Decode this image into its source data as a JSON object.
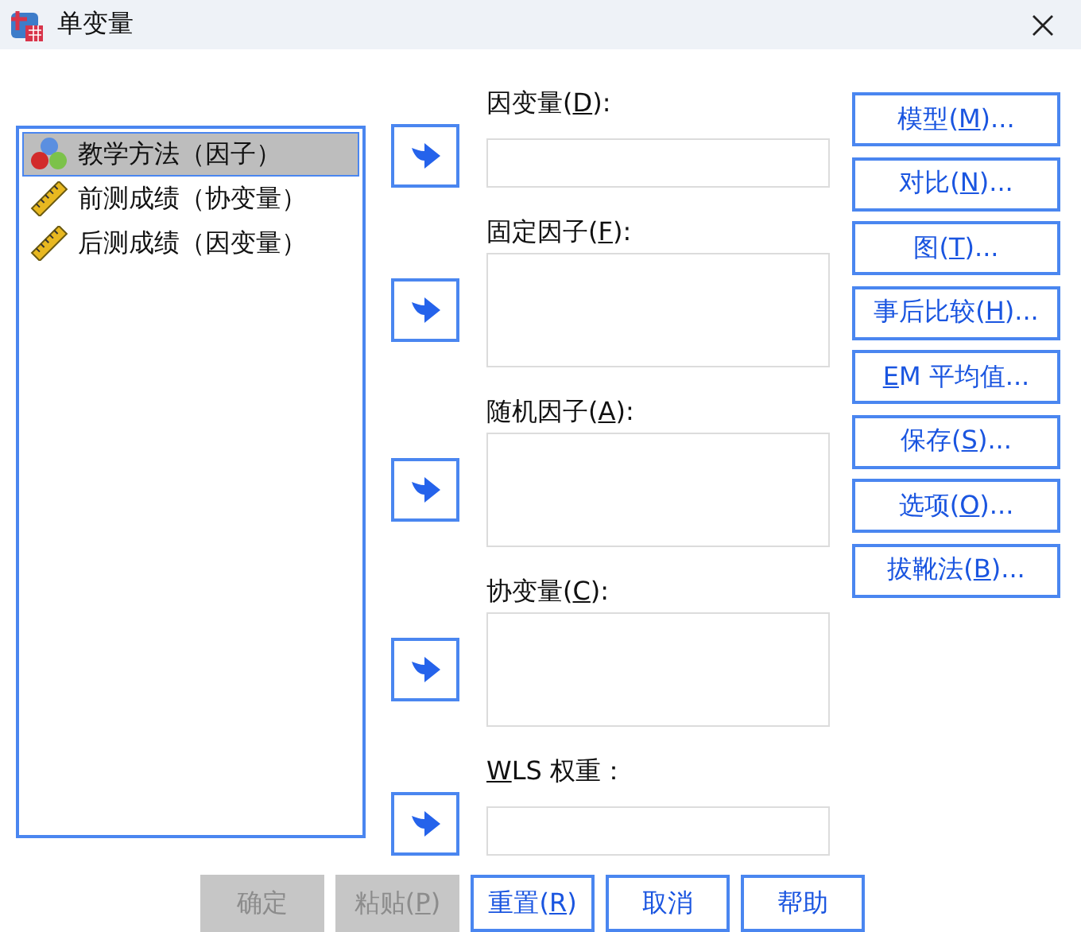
{
  "window": {
    "title": "单变量"
  },
  "variables": [
    {
      "name": "教学方法（因子）",
      "kind": "nominal",
      "selected": true
    },
    {
      "name": "前测成绩（协变量）",
      "kind": "scale",
      "selected": false
    },
    {
      "name": "后测成绩（因变量）",
      "kind": "scale",
      "selected": false
    }
  ],
  "targets": [
    {
      "before": "因变量(",
      "mnemonic": "D",
      "after": "):",
      "kind": "single"
    },
    {
      "before": "固定因子(",
      "mnemonic": "F",
      "after": "):",
      "kind": "multi"
    },
    {
      "before": "随机因子(",
      "mnemonic": "A",
      "after": "):",
      "kind": "multi"
    },
    {
      "before": "协变量(",
      "mnemonic": "C",
      "after": "):",
      "kind": "multi"
    },
    {
      "mnemonic": "W",
      "after": "LS 权重：",
      "kind": "single"
    }
  ],
  "side_buttons": [
    {
      "before": "模型(",
      "mnemonic": "M",
      "after": ")..."
    },
    {
      "before": "对比(",
      "mnemonic": "N",
      "after": ")..."
    },
    {
      "before": "图(",
      "mnemonic": "T",
      "after": ")..."
    },
    {
      "before": "事后比较(",
      "mnemonic": "H",
      "after": ")..."
    },
    {
      "mnemonic": "E",
      "after": "M 平均值..."
    },
    {
      "before": "保存(",
      "mnemonic": "S",
      "after": ")..."
    },
    {
      "before": "选项(",
      "mnemonic": "O",
      "after": ")..."
    },
    {
      "before": "拔靴法(",
      "mnemonic": "B",
      "after": ")..."
    }
  ],
  "buttons": [
    {
      "before": "确定",
      "disabled": true
    },
    {
      "before": "粘贴(",
      "mnemonic": "P",
      "after": ")",
      "disabled": true
    },
    {
      "before": "重置(",
      "mnemonic": "R",
      "after": ")",
      "disabled": false
    },
    {
      "before": "取消",
      "disabled": false
    },
    {
      "before": "帮助",
      "disabled": false
    }
  ]
}
